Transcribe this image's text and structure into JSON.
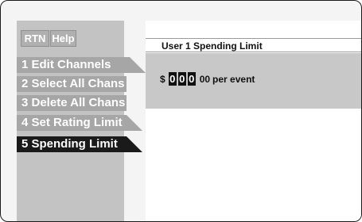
{
  "header": {
    "rtn_label": "RTN",
    "help_label": "Help"
  },
  "menu": [
    {
      "label": "1 Edit Channels"
    },
    {
      "label": "2 Select All Chans"
    },
    {
      "label": "3 Delete All Chans"
    },
    {
      "label": "4 Set  Rating Limit"
    },
    {
      "label": "5 Spending Limit"
    }
  ],
  "panel": {
    "title": "User 1 Spending Limit",
    "currency": "$",
    "digits": [
      "0",
      "0",
      "0"
    ],
    "cents": "00",
    "suffix": "per event"
  }
}
